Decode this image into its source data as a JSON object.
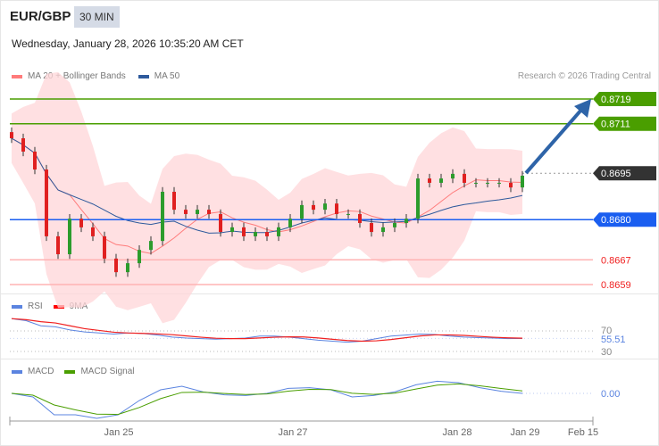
{
  "header": {
    "symbol": "EUR/GBP",
    "timeframe": "30 MIN",
    "datetime": "Wednesday, January 28, 2026 10:35:20 AM CET"
  },
  "legend": {
    "ma20": "MA 20 + Bollinger Bands",
    "ma50": "MA 50",
    "rsi": "RSI",
    "rsi_ma": "9MA",
    "macd": "MACD",
    "macd_signal": "MACD Signal"
  },
  "copyright": "Research © 2026 Trading Central",
  "colors": {
    "resistance": "#4a9e00",
    "pivot": "#1a5ef0",
    "support": "#ff2b2b",
    "current": "#333333",
    "arrow": "#2e64a8",
    "up": "#2c9c2c",
    "down": "#e02020"
  },
  "levels": [
    {
      "label": "0.8719",
      "value": 0.8719,
      "type": "resistance"
    },
    {
      "label": "0.8711",
      "value": 0.8711,
      "type": "resistance"
    },
    {
      "label": "0.8695",
      "value": 0.8695,
      "type": "current"
    },
    {
      "label": "0.8680",
      "value": 0.868,
      "type": "pivot"
    },
    {
      "label": "0.8667",
      "value": 0.8667,
      "type": "support"
    },
    {
      "label": "0.8659",
      "value": 0.8659,
      "type": "support"
    }
  ],
  "rsi_labels": {
    "upper": "70",
    "current": "55.51",
    "lower": "30"
  },
  "macd_label": "0.00",
  "x_ticks": [
    "Jan 25",
    "Jan 27",
    "Jan 28",
    "Jan 29",
    "Feb 15"
  ],
  "chart_data": {
    "type": "line",
    "title": "EUR/GBP 30 MIN",
    "ylim": [
      0.8656,
      0.8725
    ],
    "closes": [
      0.87063,
      0.8702,
      0.86962,
      0.86746,
      0.86688,
      0.86803,
      0.86775,
      0.86746,
      0.86674,
      0.8663,
      0.86659,
      0.86702,
      0.86731,
      0.8689,
      0.86832,
      0.86818,
      0.86832,
      0.86818,
      0.8676,
      0.86775,
      0.86746,
      0.8676,
      0.86746,
      0.86775,
      0.86803,
      0.86847,
      0.86832,
      0.86852,
      0.86818,
      0.86818,
      0.86789,
      0.8676,
      0.86775,
      0.86789,
      0.86803,
      0.86933,
      0.86919,
      0.86933,
      0.86948,
      0.86919,
      0.86919,
      0.86919,
      0.86919,
      0.86904,
      0.86942
    ],
    "rsi": [
      94,
      90,
      80,
      78,
      72,
      68,
      66,
      64,
      66,
      65,
      62,
      58,
      56,
      55,
      54,
      55,
      56,
      60,
      60,
      58,
      55,
      52,
      50,
      48,
      50,
      55,
      60,
      62,
      64,
      63,
      60,
      58,
      57,
      56,
      55,
      55.51
    ],
    "rsi_range": [
      30,
      70
    ],
    "macd": [
      0,
      -0.5,
      -3,
      -3,
      -3.5,
      -3,
      -1,
      0.5,
      1,
      0.2,
      -0.2,
      -0.3,
      0,
      0.7,
      0.8,
      0.5,
      -0.5,
      -0.3,
      0.2,
      1.2,
      1.7,
      1.5,
      0.8,
      0.3,
      0
    ]
  }
}
